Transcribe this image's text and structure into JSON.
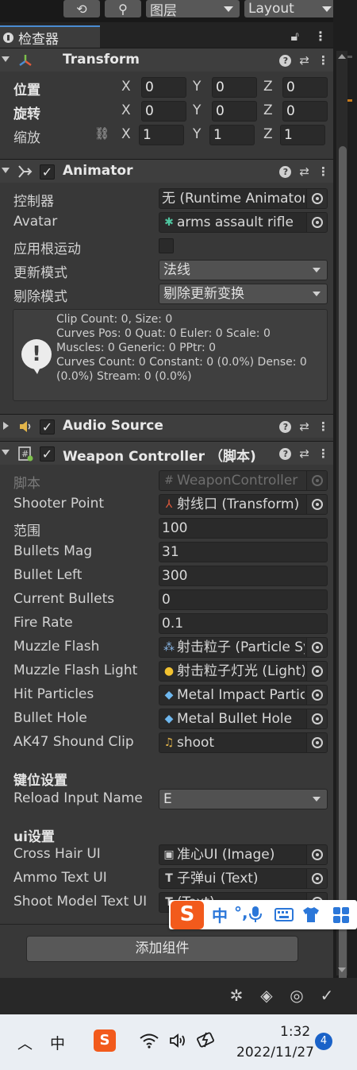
{
  "toolbar": {
    "history_icon": "history-icon",
    "search_icon": "search-icon",
    "layer_dropdown": "图层",
    "layout_dropdown": "Layout"
  },
  "tab": {
    "label": "检查器"
  },
  "transform": {
    "title": "Transform",
    "position": {
      "label": "位置",
      "x": "0",
      "y": "0",
      "z": "0"
    },
    "rotation": {
      "label": "旋转",
      "x": "0",
      "y": "0",
      "z": "0"
    },
    "scale": {
      "label": "缩放",
      "x": "1",
      "y": "1",
      "z": "1"
    },
    "axes": {
      "x": "X",
      "y": "Y",
      "z": "Z"
    }
  },
  "animator": {
    "title": "Animator",
    "controller": {
      "label": "控制器",
      "value": "无 (Runtime Animator Controller)"
    },
    "avatar": {
      "label": "Avatar",
      "value": "arms assault rifle"
    },
    "apply_root_motion": {
      "label": "应用根运动"
    },
    "update_mode": {
      "label": "更新模式",
      "value": "法线"
    },
    "culling_mode": {
      "label": "剔除模式",
      "value": "剔除更新变换"
    },
    "info_lines": [
      "Clip Count: 0, Size: 0",
      "Curves Pos: 0 Quat: 0 Euler: 0 Scale: 0",
      "Muscles: 0 Generic: 0 PPtr: 0",
      "Curves Count: 0 Constant: 0 (0.0%) Dense: 0",
      "(0.0%) Stream: 0 (0.0%)"
    ]
  },
  "audio_source": {
    "title": "Audio Source"
  },
  "weapon_controller": {
    "title": "Weapon Controller （脚本)",
    "script": {
      "label": "脚本",
      "value": "WeaponController"
    },
    "shooter_point": {
      "label": "Shooter Point",
      "value": "射线口 (Transform)"
    },
    "range": {
      "label": "范围",
      "value": "100"
    },
    "bullets_mag": {
      "label": "Bullets Mag",
      "value": "31"
    },
    "bullet_left": {
      "label": "Bullet Left",
      "value": "300"
    },
    "current_bullets": {
      "label": "Current Bullets",
      "value": "0"
    },
    "fire_rate": {
      "label": "Fire Rate",
      "value": "0.1"
    },
    "muzzle_flash": {
      "label": "Muzzle Flash",
      "value": "射击粒子 (Particle System)"
    },
    "muzzle_flash_light": {
      "label": "Muzzle Flash Light",
      "value": "射击粒子灯光 (Light)"
    },
    "hit_particles": {
      "label": "Hit Particles",
      "value": "Metal Impact Particles"
    },
    "bullet_hole": {
      "label": "Bullet Hole",
      "value": "Metal Bullet Hole"
    },
    "sound_clip": {
      "label": "AK47 Shound Clip",
      "value": "shoot"
    },
    "key_section": "键位设置",
    "reload_input": {
      "label": "Reload Input Name",
      "value": "E"
    },
    "ui_section": "ui设置",
    "cross_hair": {
      "label": "Cross Hair UI",
      "value": "准心UI (Image)"
    },
    "ammo_text": {
      "label": "Ammo Text UI",
      "value": "子弹ui (Text)"
    },
    "shoot_model_text": {
      "label": "Shoot Model Text UI",
      "value": "(Text)"
    }
  },
  "add_component": "添加组件",
  "ime": {
    "logo": "S",
    "chinese": "中",
    "punct": "°,",
    "mic_icon": "microphone-icon",
    "keyboard_icon": "keyboard-icon",
    "skin_icon": "shirt-icon",
    "apps_icon": "apps-icon"
  },
  "taskbar": {
    "ime_lang": "中",
    "time": "1:32",
    "date": "2022/11/27",
    "notifications": "4"
  }
}
